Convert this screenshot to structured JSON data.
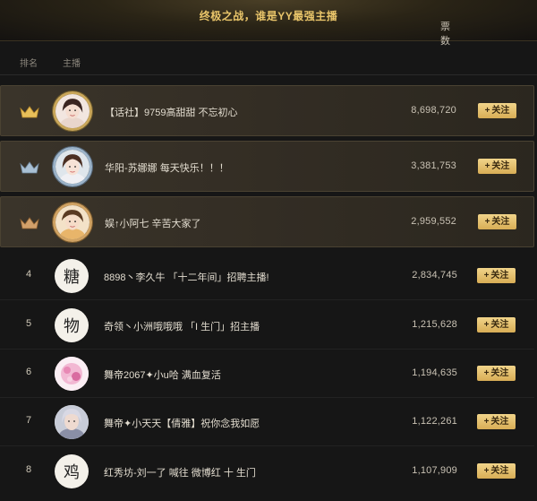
{
  "banner": {
    "title": "终极之战，谁是YY最强主播"
  },
  "header": {
    "rank": "排名",
    "anchor": "主播",
    "votes": "票数"
  },
  "follow_label": "关注",
  "rows": [
    {
      "rank": "",
      "crown": "gold",
      "name": "【话社】9759高甜甜 不忘初心",
      "votes": "8,698,720"
    },
    {
      "rank": "",
      "crown": "silver",
      "name": "华阳-苏娜娜 每天快乐！！！",
      "votes": "3,381,753"
    },
    {
      "rank": "",
      "crown": "bronze",
      "name": "娱↑小阿七 辛苦大家了",
      "votes": "2,959,552"
    },
    {
      "rank": "4",
      "crown": "",
      "name": "8898丶李久牛 「十二年间」招聘主播!",
      "votes": "2,834,745",
      "avatar_glyph": "糖"
    },
    {
      "rank": "5",
      "crown": "",
      "name": "奇领丶小洲哦哦哦 「I 生门」招主播",
      "votes": "1,215,628",
      "avatar_glyph": "物"
    },
    {
      "rank": "6",
      "crown": "",
      "name": "舞帝2067✦小u哈 满血复活",
      "votes": "1,194,635",
      "avatar_glyph": ""
    },
    {
      "rank": "7",
      "crown": "",
      "name": "舞帝✦小天天【倩雅】祝你念我如愿",
      "votes": "1,122,261",
      "avatar_glyph": ""
    },
    {
      "rank": "8",
      "crown": "",
      "name": "红秀坊-刘一了 喊往 微博红 十 生门",
      "votes": "1,107,909",
      "avatar_glyph": "鸡"
    }
  ],
  "colors": {
    "accent": "#e9c56a",
    "button": "#e6c06d",
    "background": "#161616"
  }
}
